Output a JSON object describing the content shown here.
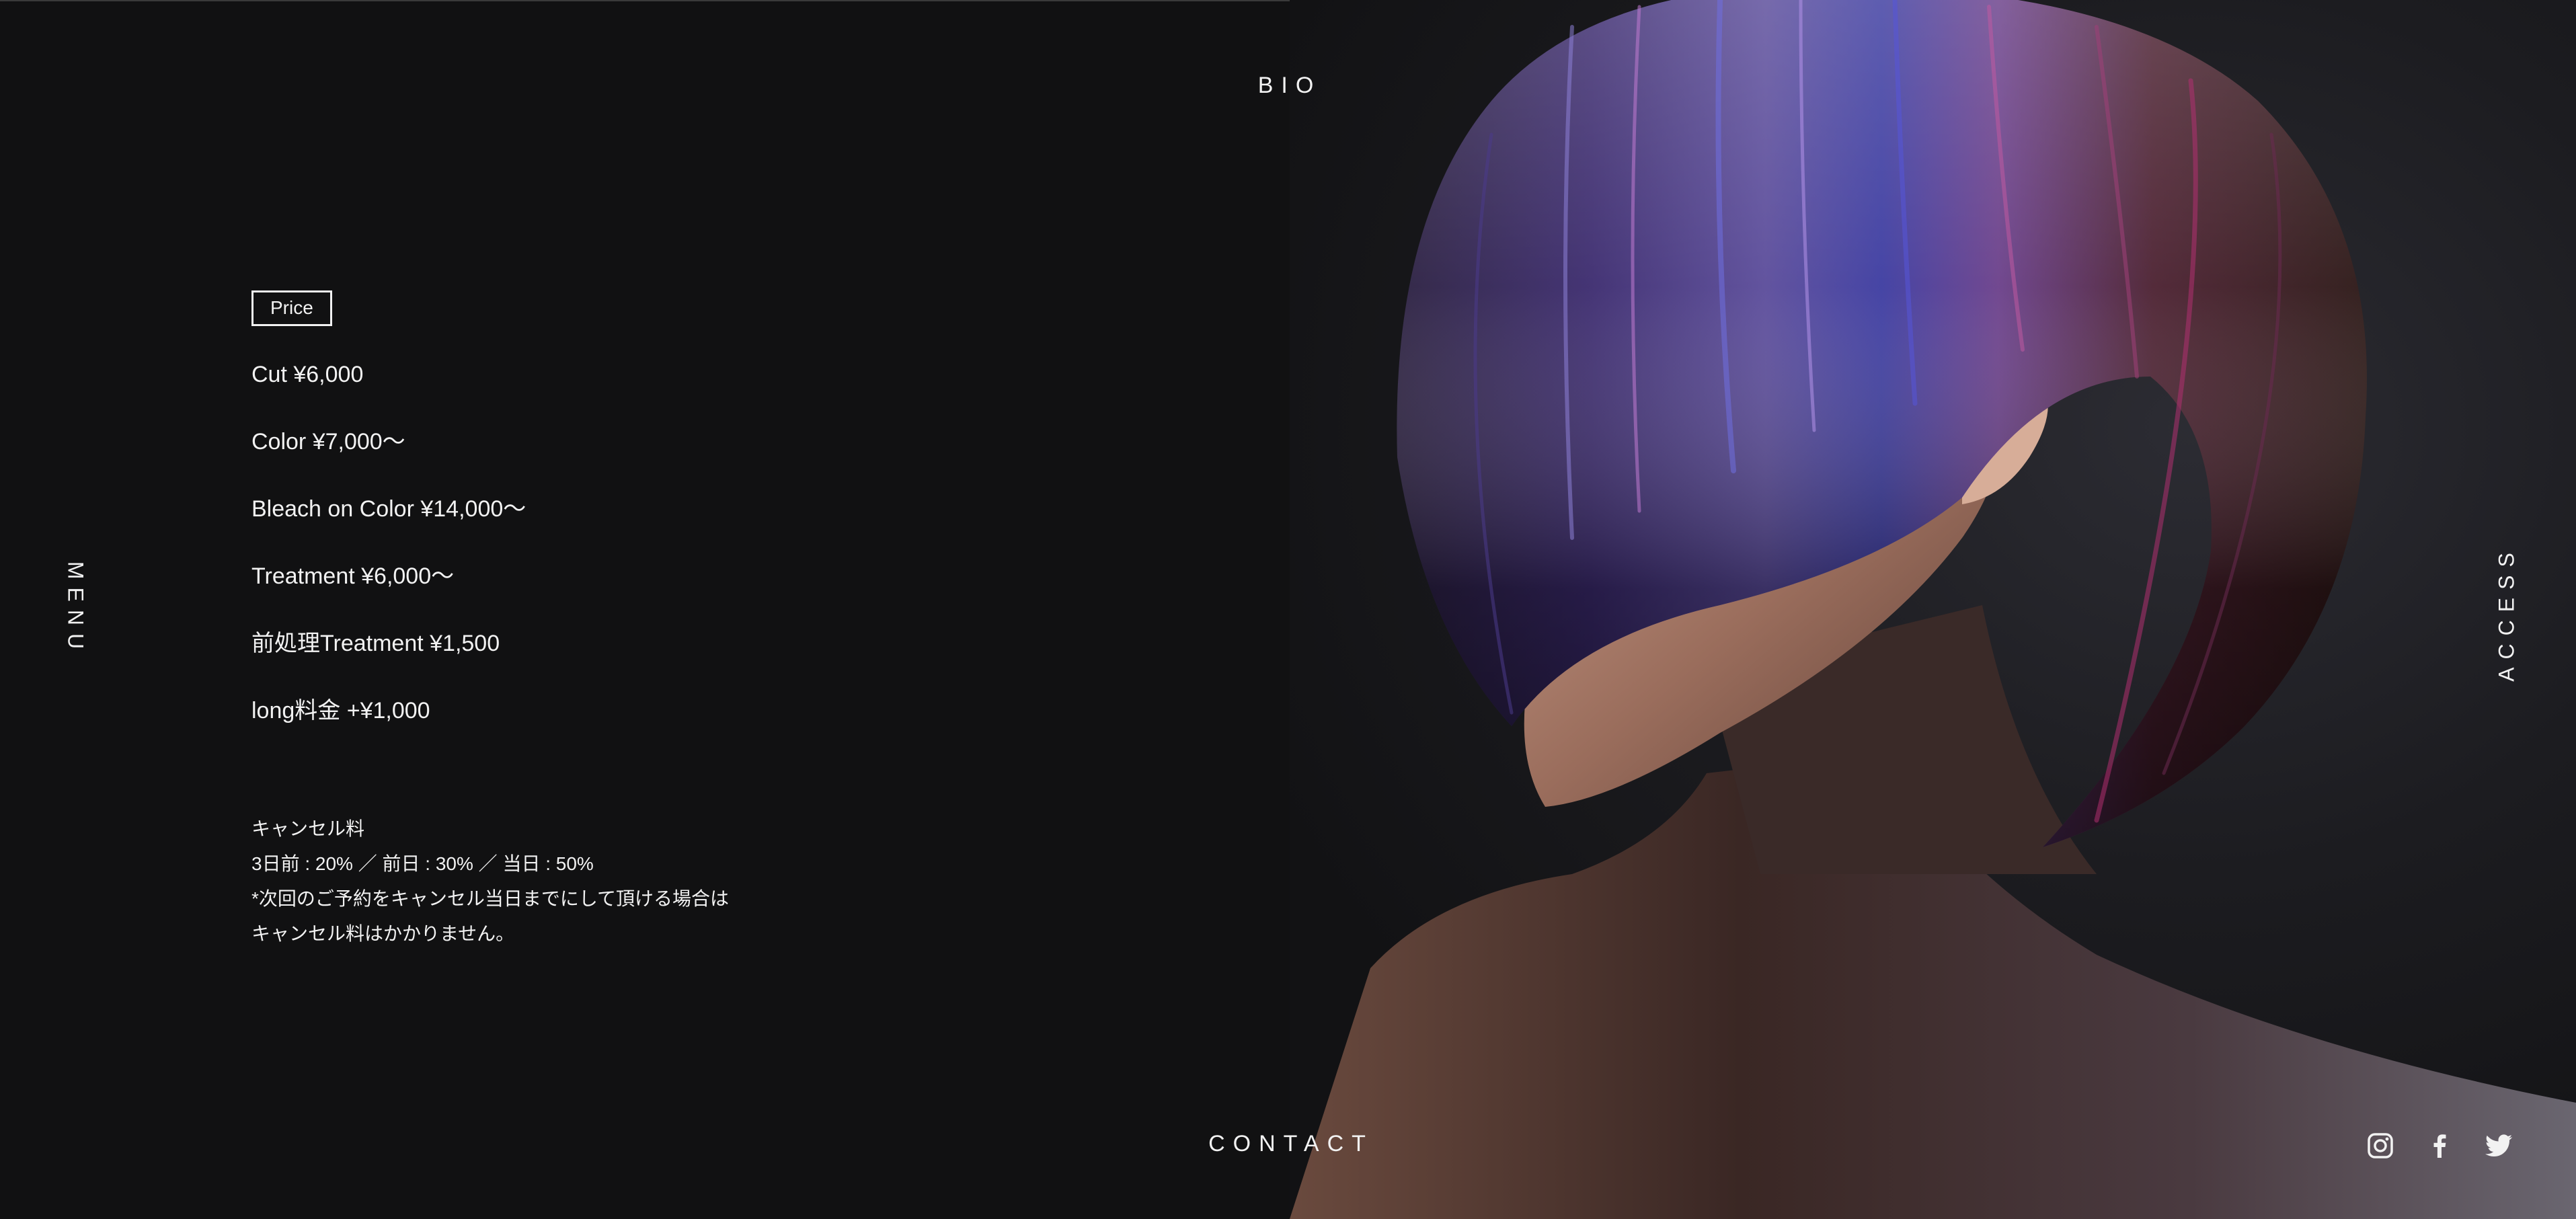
{
  "nav": {
    "top": "BIO",
    "bottom": "CONTACT",
    "left": "MENU",
    "right": "ACCESS"
  },
  "price": {
    "tag": "Price",
    "items": [
      "Cut ¥6,000",
      "Color ¥7,000〜",
      "Bleach on Color ¥14,000〜",
      "Treatment ¥6,000〜",
      "前処理Treatment ¥1,500",
      "long料金 +¥1,000"
    ]
  },
  "cancel": {
    "title": "キャンセル料",
    "rates": "3日前 : 20% ／ 前日 : 30% ／ 当日 : 50%",
    "note_line1": "*次回のご予約をキャンセル当日までにして頂ける場合は",
    "note_line2": "キャンセル料はかかりません。"
  },
  "social": {
    "icons": [
      "instagram-icon",
      "facebook-icon",
      "twitter-icon"
    ]
  },
  "colors": {
    "background": "#111112",
    "text": "#f2f2f2"
  }
}
